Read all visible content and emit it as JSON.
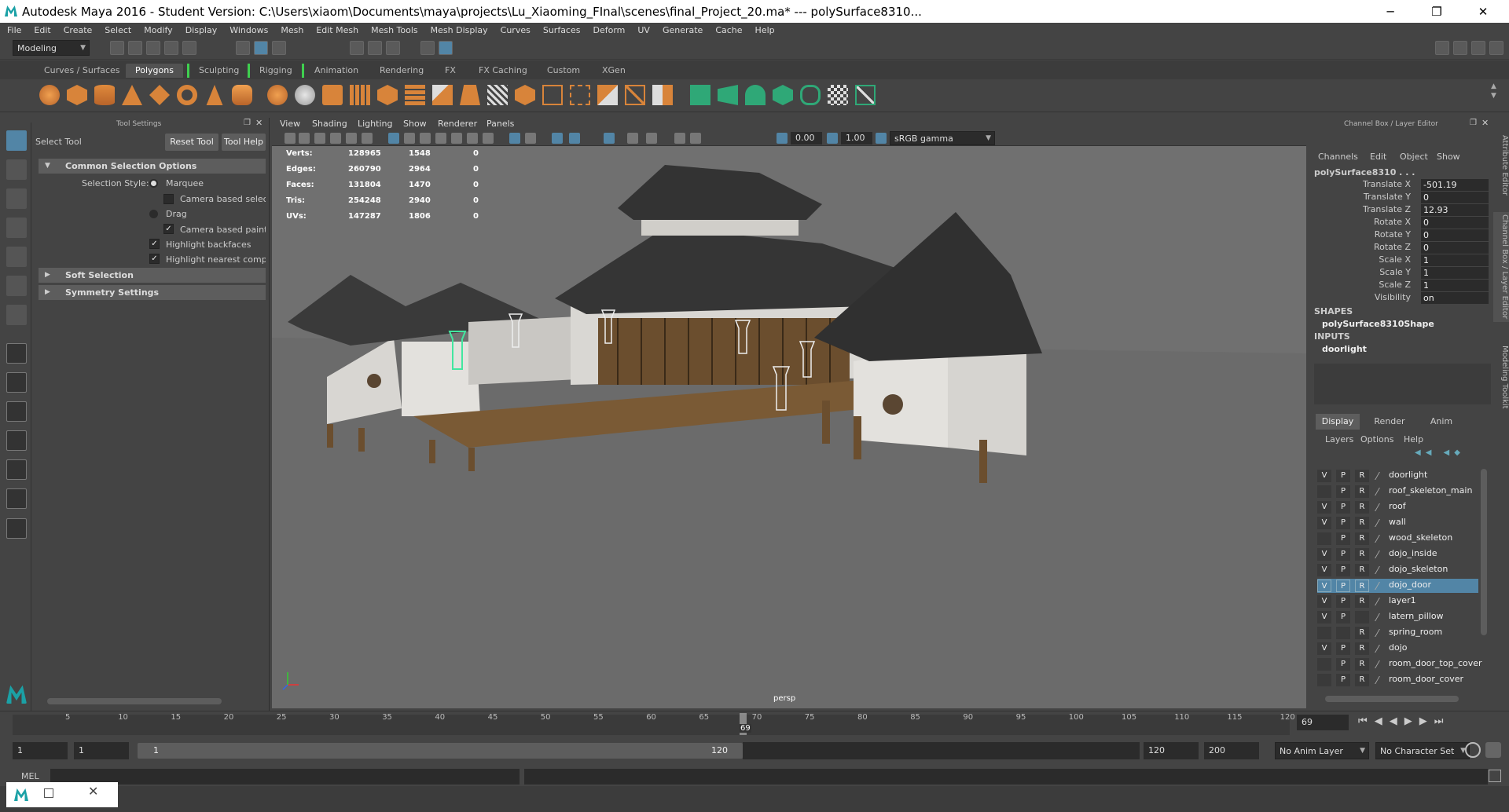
{
  "window": {
    "title": "Autodesk Maya 2016 - Student Version: C:\\Users\\xiaom\\Documents\\maya\\projects\\Lu_Xiaoming_FInal\\scenes\\final_Project_20.ma*   ---   polySurface8310...",
    "min": "─",
    "max": "❐",
    "close": "✕"
  },
  "menu": [
    "File",
    "Edit",
    "Create",
    "Select",
    "Modify",
    "Display",
    "Windows",
    "Mesh",
    "Edit Mesh",
    "Mesh Tools",
    "Mesh Display",
    "Curves",
    "Surfaces",
    "Deform",
    "UV",
    "Generate",
    "Cache",
    "Help"
  ],
  "status": {
    "mode": "Modeling"
  },
  "shelf_tabs": [
    "Curves / Surfaces",
    "Polygons",
    "Sculpting",
    "Rigging",
    "Animation",
    "Rendering",
    "FX",
    "FX Caching",
    "Custom",
    "XGen"
  ],
  "shelf_active": "Polygons",
  "tool_settings": {
    "header": "Tool Settings",
    "tool_name": "Select Tool",
    "reset_btn": "Reset Tool",
    "help_btn": "Tool Help",
    "sec_common": "Common Selection Options",
    "selection_style_label": "Selection Style:",
    "marquee": "Marquee",
    "camera_based_selection": "Camera based selecti",
    "drag": "Drag",
    "camera_based_paint": "Camera based paint s",
    "highlight_backfaces": "Highlight backfaces",
    "highlight_nearest": "Highlight nearest compo",
    "sec_soft": "Soft Selection",
    "sec_symmetry": "Symmetry Settings"
  },
  "viewport": {
    "menus": [
      "View",
      "Shading",
      "Lighting",
      "Show",
      "Renderer",
      "Panels"
    ],
    "exposure": "0.00",
    "gamma": "1.00",
    "colorspace": "sRGB gamma",
    "camera": "persp",
    "hud": [
      {
        "label": "Verts:",
        "a": "128965",
        "b": "1548",
        "c": "0"
      },
      {
        "label": "Edges:",
        "a": "260790",
        "b": "2964",
        "c": "0"
      },
      {
        "label": "Faces:",
        "a": "131804",
        "b": "1470",
        "c": "0"
      },
      {
        "label": "Tris:",
        "a": "254248",
        "b": "2940",
        "c": "0"
      },
      {
        "label": "UVs:",
        "a": "147287",
        "b": "1806",
        "c": "0"
      }
    ]
  },
  "channel_box": {
    "header": "Channel Box / Layer Editor",
    "menus": [
      "Channels",
      "Edit",
      "Object",
      "Show"
    ],
    "object": "polySurface8310 . . .",
    "channels": [
      {
        "name": "Translate X",
        "value": "-501.19"
      },
      {
        "name": "Translate Y",
        "value": "0"
      },
      {
        "name": "Translate Z",
        "value": "12.93"
      },
      {
        "name": "Rotate X",
        "value": "0"
      },
      {
        "name": "Rotate Y",
        "value": "0"
      },
      {
        "name": "Rotate Z",
        "value": "0"
      },
      {
        "name": "Scale X",
        "value": "1"
      },
      {
        "name": "Scale Y",
        "value": "1"
      },
      {
        "name": "Scale Z",
        "value": "1"
      },
      {
        "name": "Visibility",
        "value": "on"
      }
    ],
    "shapes_label": "SHAPES",
    "shape": "polySurface8310Shape",
    "inputs_label": "INPUTS",
    "input": "doorlight",
    "side_tabs": [
      "Attribute Editor",
      "Channel Box / Layer Editor",
      "Modeling Toolkit"
    ]
  },
  "layer_editor": {
    "tabs": [
      "Display",
      "Render",
      "Anim"
    ],
    "menus": [
      "Layers",
      "Options",
      "Help"
    ],
    "layers": [
      {
        "v": "V",
        "p": "P",
        "r": "R",
        "name": "doorlight",
        "sel": false
      },
      {
        "v": "",
        "p": "P",
        "r": "R",
        "name": "roof_skeleton_main",
        "sel": false
      },
      {
        "v": "V",
        "p": "P",
        "r": "R",
        "name": "roof",
        "sel": false
      },
      {
        "v": "V",
        "p": "P",
        "r": "R",
        "name": "wall",
        "sel": false
      },
      {
        "v": "",
        "p": "P",
        "r": "R",
        "name": "wood_skeleton",
        "sel": false
      },
      {
        "v": "V",
        "p": "P",
        "r": "R",
        "name": "dojo_inside",
        "sel": false
      },
      {
        "v": "V",
        "p": "P",
        "r": "R",
        "name": "dojo_skeleton",
        "sel": false
      },
      {
        "v": "V",
        "p": "P",
        "r": "R",
        "name": "dojo_door",
        "sel": true
      },
      {
        "v": "V",
        "p": "P",
        "r": "R",
        "name": "layer1",
        "sel": false
      },
      {
        "v": "V",
        "p": "P",
        "r": "",
        "name": "latern_pillow",
        "sel": false
      },
      {
        "v": "",
        "p": "",
        "r": "R",
        "name": "spring_room",
        "sel": false
      },
      {
        "v": "V",
        "p": "P",
        "r": "R",
        "name": "dojo",
        "sel": false
      },
      {
        "v": "",
        "p": "P",
        "r": "R",
        "name": "room_door_top_cover",
        "sel": false
      },
      {
        "v": "",
        "p": "P",
        "r": "R",
        "name": "room_door_cover",
        "sel": false
      }
    ]
  },
  "timeline": {
    "ticks": [
      "5",
      "10",
      "15",
      "20",
      "25",
      "30",
      "35",
      "40",
      "45",
      "50",
      "55",
      "60",
      "65",
      "70",
      "75",
      "80",
      "85",
      "90",
      "95",
      "100",
      "105",
      "110",
      "115",
      "120"
    ],
    "current": "69",
    "current_field": "69"
  },
  "range": {
    "start": "1",
    "start2": "1",
    "slider_start": "1",
    "slider_end": "120",
    "end": "120",
    "end2": "200",
    "anim_layer": "No Anim Layer",
    "char_set": "No Character Set"
  },
  "cmd": {
    "label": "MEL"
  },
  "colors": {
    "accent": "#5285a6",
    "selected_wire": "#43e6a0",
    "roof": "#3a3a3a",
    "wall": "#d8d6d2",
    "wood": "#6b4e2e"
  }
}
